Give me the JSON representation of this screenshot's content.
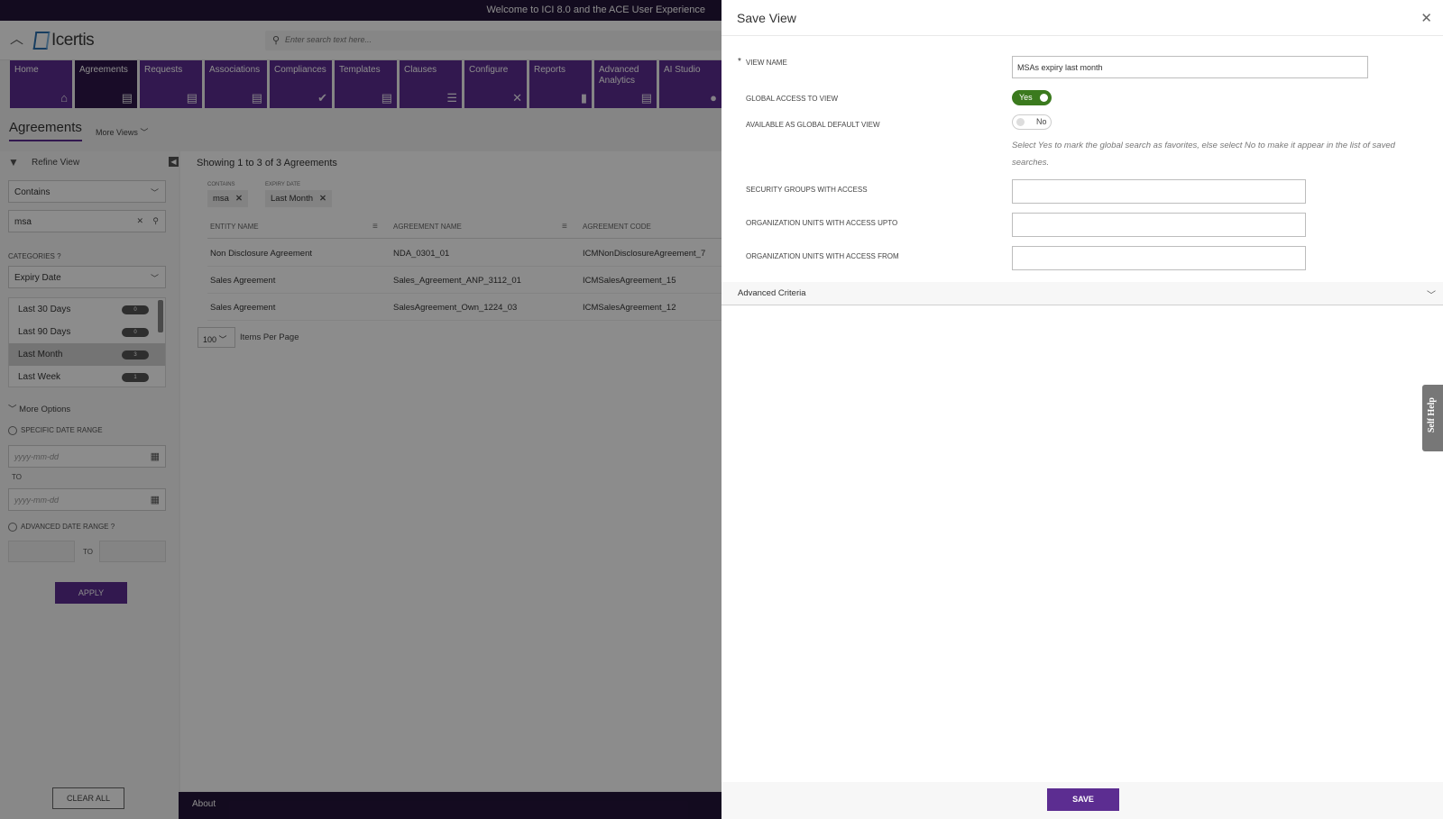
{
  "topbar": {
    "welcome": "Welcome to ICI 8.0 and the ACE User Experience"
  },
  "header": {
    "logo_text": "Icertis",
    "search_placeholder": "Enter search text here..."
  },
  "nav": [
    {
      "label": "Home",
      "icon": "home-icon",
      "glyph": "⌂"
    },
    {
      "label": "Agreements",
      "icon": "document-icon",
      "glyph": "▤"
    },
    {
      "label": "Requests",
      "icon": "document-icon",
      "glyph": "▤"
    },
    {
      "label": "Associations",
      "icon": "document-icon",
      "glyph": "▤"
    },
    {
      "label": "Compliances",
      "icon": "check-icon",
      "glyph": "✔"
    },
    {
      "label": "Templates",
      "icon": "document-icon",
      "glyph": "▤"
    },
    {
      "label": "Clauses",
      "icon": "list-icon",
      "glyph": "☰"
    },
    {
      "label": "Configure",
      "icon": "tools-icon",
      "glyph": "✕"
    },
    {
      "label": "Reports",
      "icon": "clipboard-icon",
      "glyph": "▮"
    },
    {
      "label": "Advanced Analytics",
      "icon": "document-icon",
      "glyph": "▤"
    },
    {
      "label": "AI Studio",
      "icon": "lightbulb-icon",
      "glyph": "●"
    }
  ],
  "page": {
    "title": "Agreements",
    "more_views": "More Views"
  },
  "refine": {
    "title": "Refine View",
    "match_type": "Contains",
    "search_value": "msa",
    "categories_label": "CATEGORIES",
    "category_select": "Expiry Date",
    "category_items": [
      {
        "label": "Last 30 Days",
        "count": "0"
      },
      {
        "label": "Last 90 Days",
        "count": "0"
      },
      {
        "label": "Last Month",
        "count": "3"
      },
      {
        "label": "Last Week",
        "count": "1"
      }
    ],
    "more_options": "More Options",
    "specific_date_range": "SPECIFIC DATE RANGE",
    "date_placeholder": "yyyy-mm-dd",
    "to": "TO",
    "advanced_date_range": "ADVANCED DATE RANGE",
    "apply": "APPLY",
    "clear_all": "CLEAR ALL"
  },
  "results": {
    "showing": "Showing 1 to 3 of 3 Agreements",
    "chips": [
      {
        "caption": "CONTAINS",
        "value": "msa"
      },
      {
        "caption": "EXPIRY DATE",
        "value": "Last Month"
      }
    ],
    "columns": [
      "ENTITY NAME",
      "AGREEMENT NAME",
      "AGREEMENT CODE"
    ],
    "rows": [
      [
        "Non Disclosure Agreement",
        "NDA_0301_01",
        "ICMNonDisclosureAgreement_7"
      ],
      [
        "Sales Agreement",
        "Sales_Agreement_ANP_3112_01",
        "ICMSalesAgreement_15"
      ],
      [
        "Sales Agreement",
        "SalesAgreement_Own_1224_03",
        "ICMSalesAgreement_12"
      ]
    ],
    "page_size": "100",
    "items_per_page": "Items Per Page"
  },
  "footer": {
    "about": "About"
  },
  "save_view": {
    "title": "Save View",
    "view_name_label": "VIEW NAME",
    "view_name_value": "MSAs expiry last month",
    "global_access_label": "GLOBAL ACCESS TO VIEW",
    "global_access_value": "Yes",
    "global_default_label": "AVAILABLE AS GLOBAL DEFAULT VIEW",
    "global_default_value": "No",
    "hint": "Select Yes to mark the global search as favorites, else select No to make it appear in the list of saved searches.",
    "security_groups_label": "SECURITY GROUPS WITH ACCESS",
    "org_upto_label": "ORGANIZATION UNITS WITH ACCESS UPTO",
    "org_from_label": "ORGANIZATION UNITS WITH ACCESS FROM",
    "advanced_criteria": "Advanced Criteria",
    "save": "SAVE"
  },
  "self_help": "Self Help",
  "colors": {
    "brand_purple": "#5c2d91",
    "topbar": "#24143a",
    "toggle_on": "#3b7a1e"
  }
}
